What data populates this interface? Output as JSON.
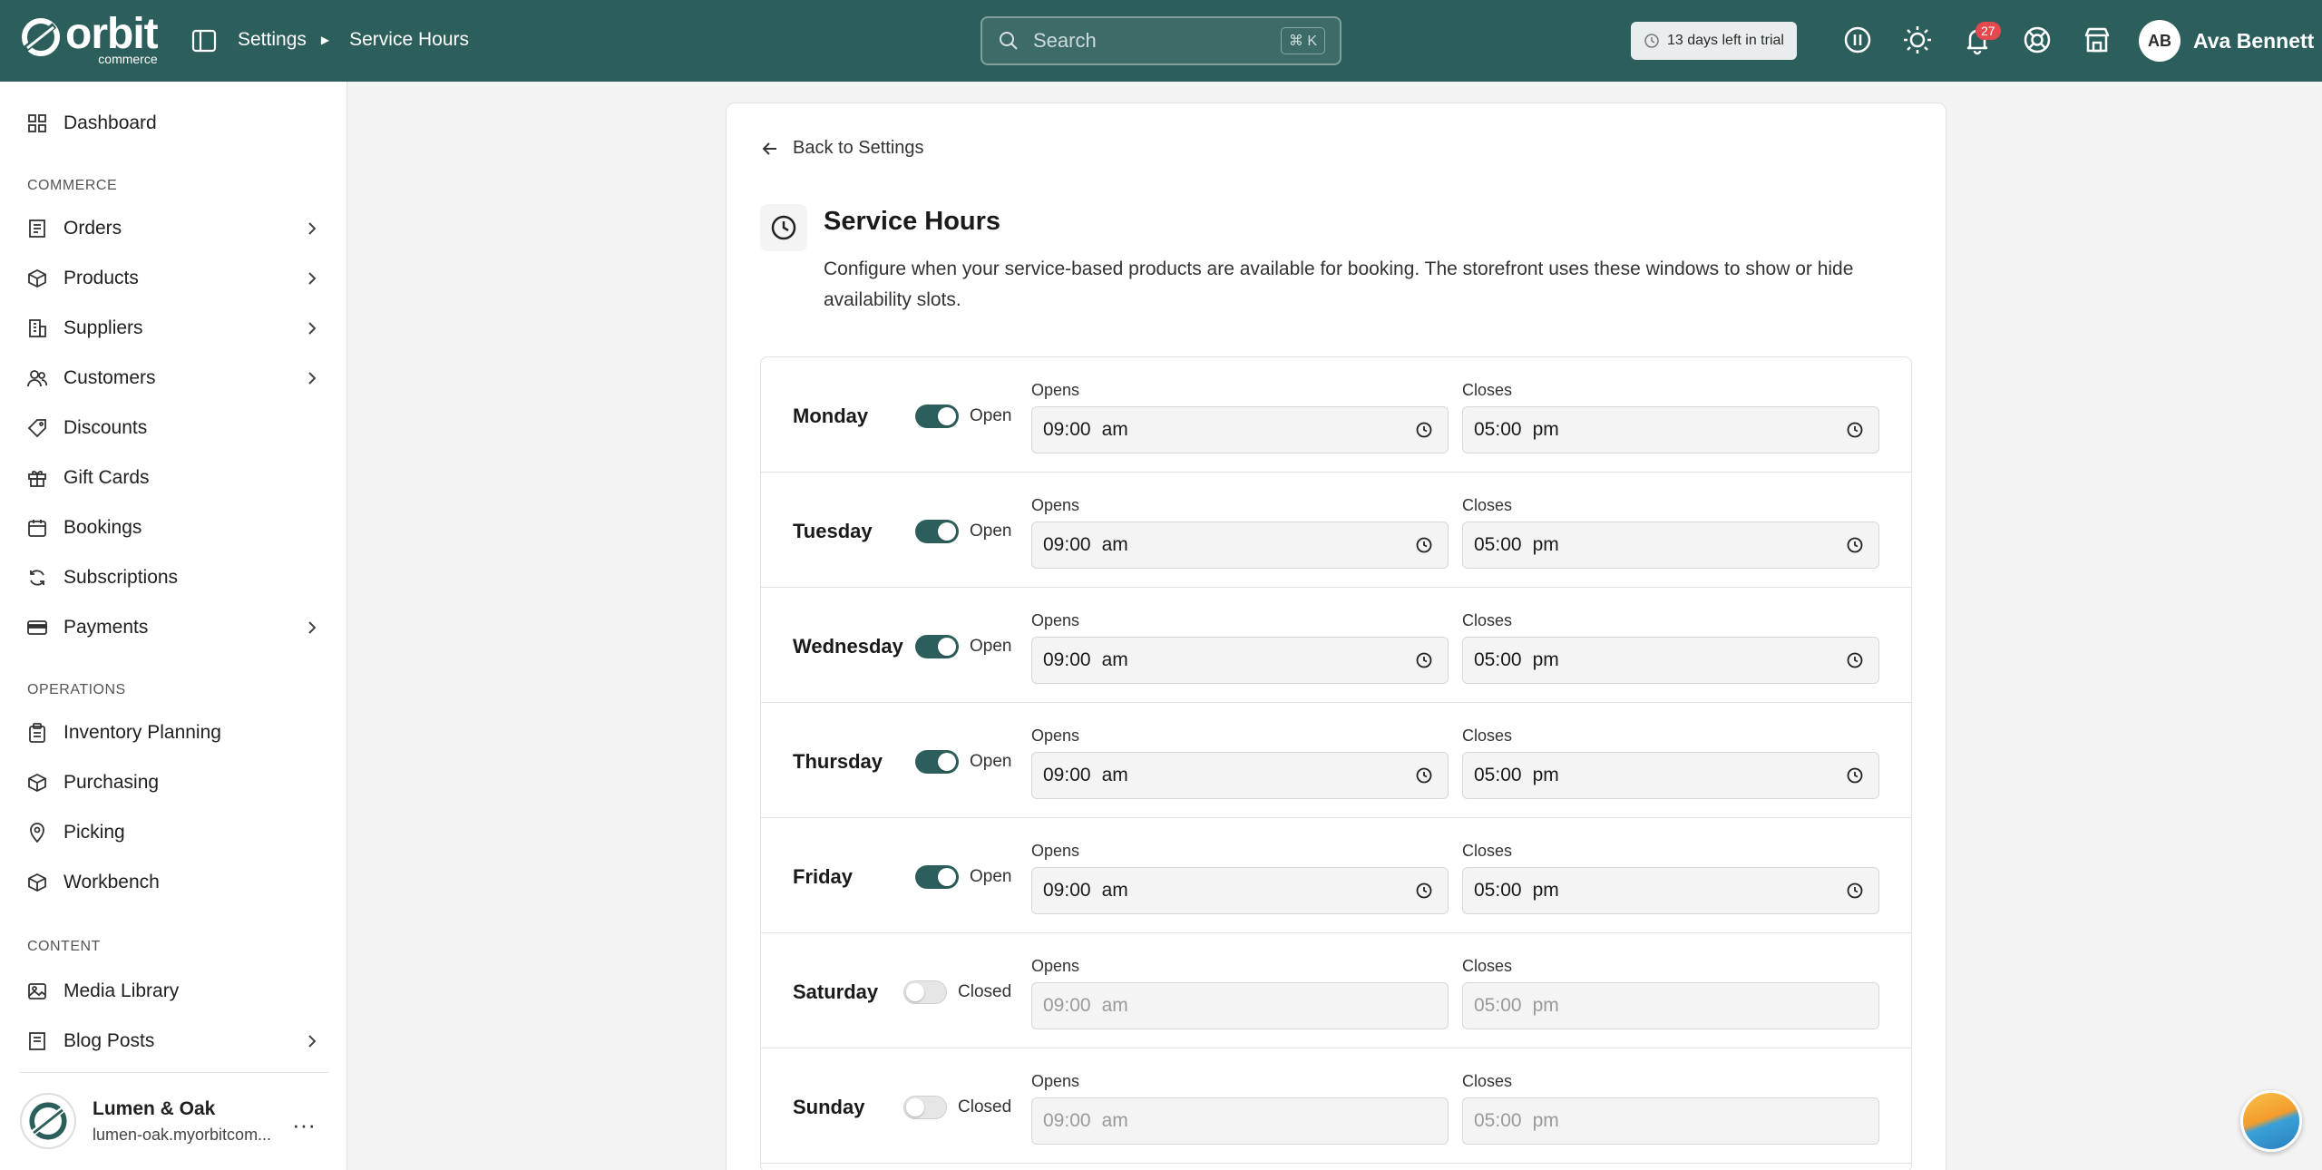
{
  "header": {
    "logo_text": "orbit",
    "logo_sub": "commerce",
    "breadcrumb": [
      "Settings",
      "Service Hours"
    ],
    "search_placeholder": "Search",
    "search_shortcut": "⌘ K",
    "trial_text": "13 days left in trial",
    "notification_count": "27",
    "avatar_initials": "AB",
    "user_name": "Ava Bennett",
    "brand_color": "#2c5f5c"
  },
  "sidebar": {
    "top_item": {
      "label": "Dashboard",
      "icon": "dashboard-icon"
    },
    "sections": [
      {
        "title": "COMMERCE",
        "items": [
          {
            "label": "Orders",
            "icon": "orders-icon",
            "expandable": true
          },
          {
            "label": "Products",
            "icon": "box-icon",
            "expandable": true
          },
          {
            "label": "Suppliers",
            "icon": "building-icon",
            "expandable": true
          },
          {
            "label": "Customers",
            "icon": "users-icon",
            "expandable": true
          },
          {
            "label": "Discounts",
            "icon": "tag-icon",
            "expandable": false
          },
          {
            "label": "Gift Cards",
            "icon": "gift-icon",
            "expandable": false
          },
          {
            "label": "Bookings",
            "icon": "calendar-icon",
            "expandable": false
          },
          {
            "label": "Subscriptions",
            "icon": "refresh-icon",
            "expandable": false
          },
          {
            "label": "Payments",
            "icon": "card-icon",
            "expandable": true
          }
        ]
      },
      {
        "title": "OPERATIONS",
        "items": [
          {
            "label": "Inventory Planning",
            "icon": "clipboard-icon"
          },
          {
            "label": "Purchasing",
            "icon": "box-icon"
          },
          {
            "label": "Picking",
            "icon": "pin-icon"
          },
          {
            "label": "Workbench",
            "icon": "box-icon"
          }
        ]
      },
      {
        "title": "CONTENT",
        "items": [
          {
            "label": "Media Library",
            "icon": "image-icon",
            "expandable": false
          },
          {
            "label": "Blog Posts",
            "icon": "document-icon",
            "expandable": true
          }
        ]
      }
    ],
    "store": {
      "name": "Lumen & Oak",
      "url": "lumen-oak.myorbitcom...",
      "more": "···"
    }
  },
  "main": {
    "back_label": "Back to Settings",
    "title": "Service Hours",
    "description": "Configure when your service-based products are available for booking. The storefront uses these windows to show or hide availability slots.",
    "opens_label": "Opens",
    "closes_label": "Closes",
    "days": [
      {
        "day": "Monday",
        "open": true,
        "state": "Open",
        "opens": "09:00",
        "opens_period": "am",
        "closes": "05:00",
        "closes_period": "pm"
      },
      {
        "day": "Tuesday",
        "open": true,
        "state": "Open",
        "opens": "09:00",
        "opens_period": "am",
        "closes": "05:00",
        "closes_period": "pm"
      },
      {
        "day": "Wednesday",
        "open": true,
        "state": "Open",
        "opens": "09:00",
        "opens_period": "am",
        "closes": "05:00",
        "closes_period": "pm"
      },
      {
        "day": "Thursday",
        "open": true,
        "state": "Open",
        "opens": "09:00",
        "opens_period": "am",
        "closes": "05:00",
        "closes_period": "pm"
      },
      {
        "day": "Friday",
        "open": true,
        "state": "Open",
        "opens": "09:00",
        "opens_period": "am",
        "closes": "05:00",
        "closes_period": "pm"
      },
      {
        "day": "Saturday",
        "open": false,
        "state": "Closed",
        "opens": "09:00",
        "opens_period": "am",
        "closes": "05:00",
        "closes_period": "pm"
      },
      {
        "day": "Sunday",
        "open": false,
        "state": "Closed",
        "opens": "09:00",
        "opens_period": "am",
        "closes": "05:00",
        "closes_period": "pm"
      }
    ]
  }
}
